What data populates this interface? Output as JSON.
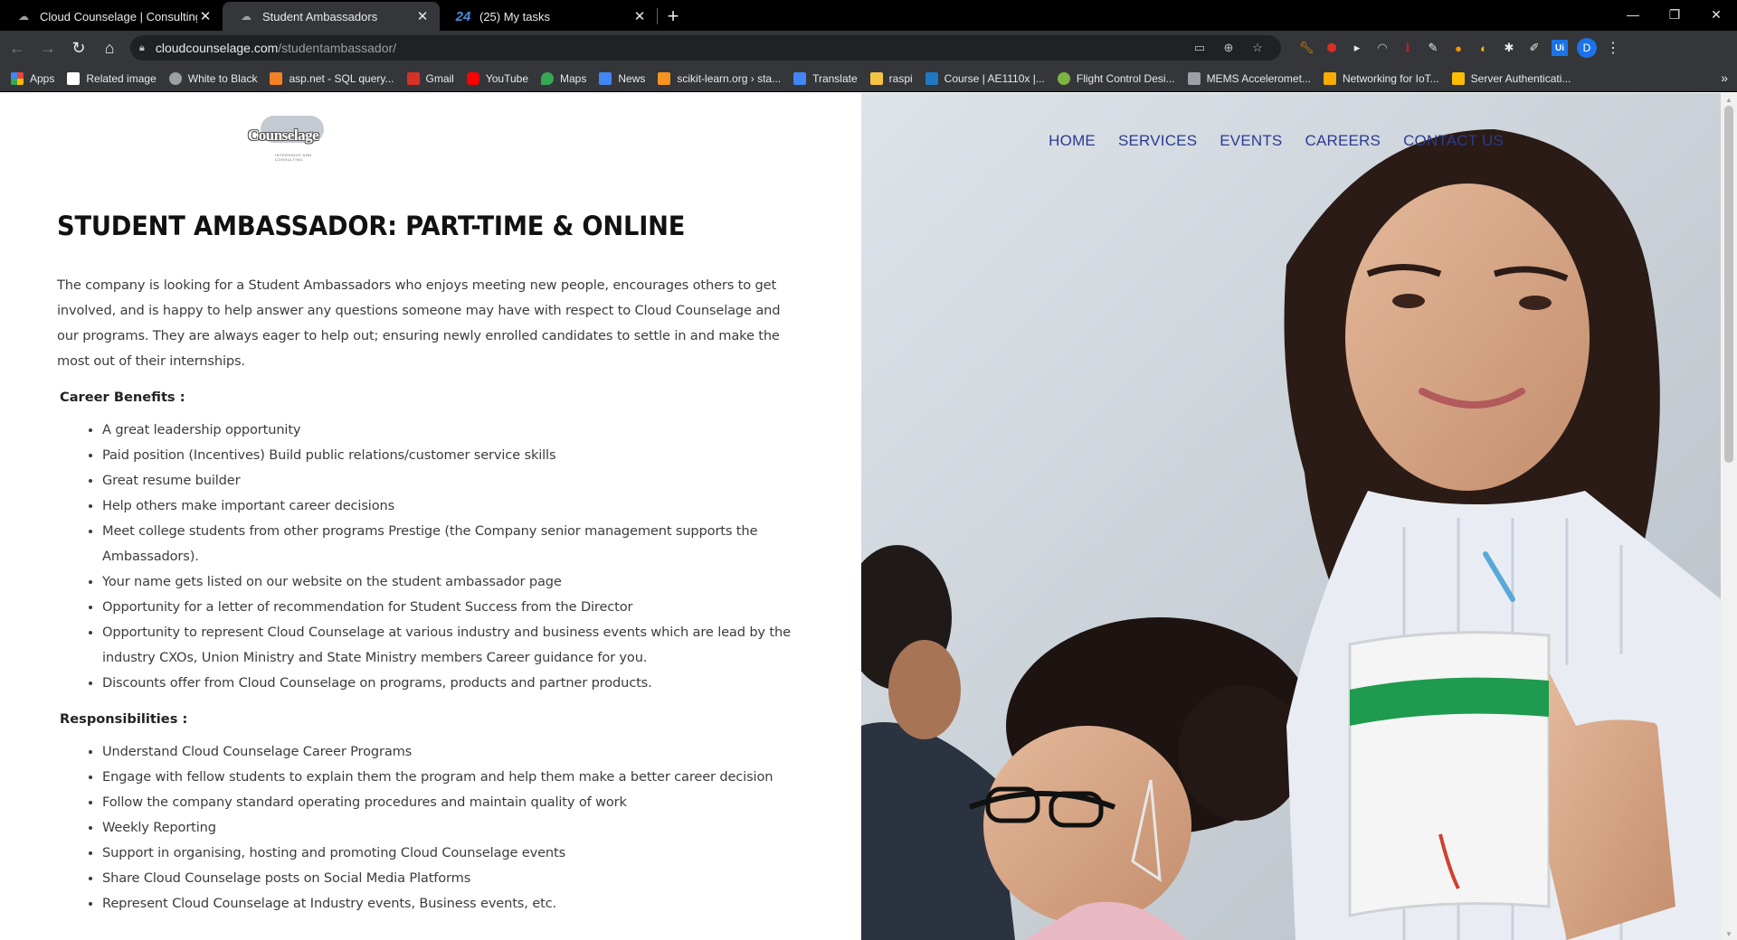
{
  "browser": {
    "tabs": [
      {
        "title": "Cloud Counselage | Consulting, A",
        "icon": "cloud-icon",
        "active": false
      },
      {
        "title": "Student Ambassadors",
        "icon": "cloud-icon",
        "active": true
      },
      {
        "title": "(25) My tasks",
        "icon": "24-icon",
        "active": false
      }
    ],
    "address": {
      "domain": "cloudcounselage.com",
      "path": "/studentambassador/"
    },
    "profile_initial": "D",
    "bookmarks": [
      {
        "label": "Apps",
        "color": "#e8453c"
      },
      {
        "label": "Related image",
        "color": "#ffffff"
      },
      {
        "label": "White to Black",
        "color": "#9aa0a6"
      },
      {
        "label": "asp.net - SQL query...",
        "color": "#f48024"
      },
      {
        "label": "Gmail",
        "color": "#d93025"
      },
      {
        "label": "YouTube",
        "color": "#ff0000"
      },
      {
        "label": "Maps",
        "color": "#34a853"
      },
      {
        "label": "News",
        "color": "#4285f4"
      },
      {
        "label": "scikit-learn.org › sta...",
        "color": "#f7931e"
      },
      {
        "label": "Translate",
        "color": "#4285f4"
      },
      {
        "label": "raspi",
        "color": "#f4c542"
      },
      {
        "label": "Course | AE1110x |...",
        "color": "#1f78c1"
      },
      {
        "label": "Flight Control Desi...",
        "color": "#7cb342"
      },
      {
        "label": "MEMS Acceleromet...",
        "color": "#9aa0a6"
      },
      {
        "label": "Networking for IoT...",
        "color": "#f9ab00"
      },
      {
        "label": "Server Authenticati...",
        "color": "#fbbc04"
      }
    ]
  },
  "site": {
    "logo_text": "Counselage",
    "logo_tagline": "INTERNSHIP AND CONSULTING",
    "nav": [
      "HOME",
      "SERVICES",
      "EVENTS",
      "CAREERS",
      "CONTACT US"
    ],
    "title": "STUDENT AMBASSADOR: PART-TIME & ONLINE",
    "intro": "The company is looking for a Student Ambassadors who enjoys meeting new people, encourages others to get involved, and is happy to help answer any questions someone may have with respect to Cloud Counselage and our programs. They are always eager to help out; ensuring newly enrolled candidates to settle in and make the most out of their internships.",
    "benefits_heading": "Career Benefits :",
    "benefits": [
      "A great leadership opportunity",
      "Paid position (Incentives) Build public relations/customer service skills",
      "Great resume builder",
      "Help others make important career decisions",
      "Meet college students from other programs Prestige (the Company senior management supports the Ambassadors).",
      "Your name gets listed on our website on the student ambassador page",
      "Opportunity for a letter of recommendation for Student Success from the Director",
      "Opportunity to represent Cloud Counselage at various industry and business events which are lead by the industry CXOs, Union Ministry and State Ministry members Career guidance for you.",
      "Discounts offer from Cloud Counselage on programs, products and partner products."
    ],
    "responsibilities_heading": "Responsibilities :",
    "responsibilities": [
      "Understand Cloud Counselage Career Programs",
      "Engage with fellow students to explain them the program and help them make a better career decision",
      "Follow the company standard operating procedures and maintain quality of work",
      "Weekly Reporting",
      "Support in organising, hosting and promoting Cloud Counselage events",
      "Share Cloud Counselage posts on Social Media Platforms",
      "Represent Cloud Counselage at Industry events, Business events, etc."
    ]
  }
}
